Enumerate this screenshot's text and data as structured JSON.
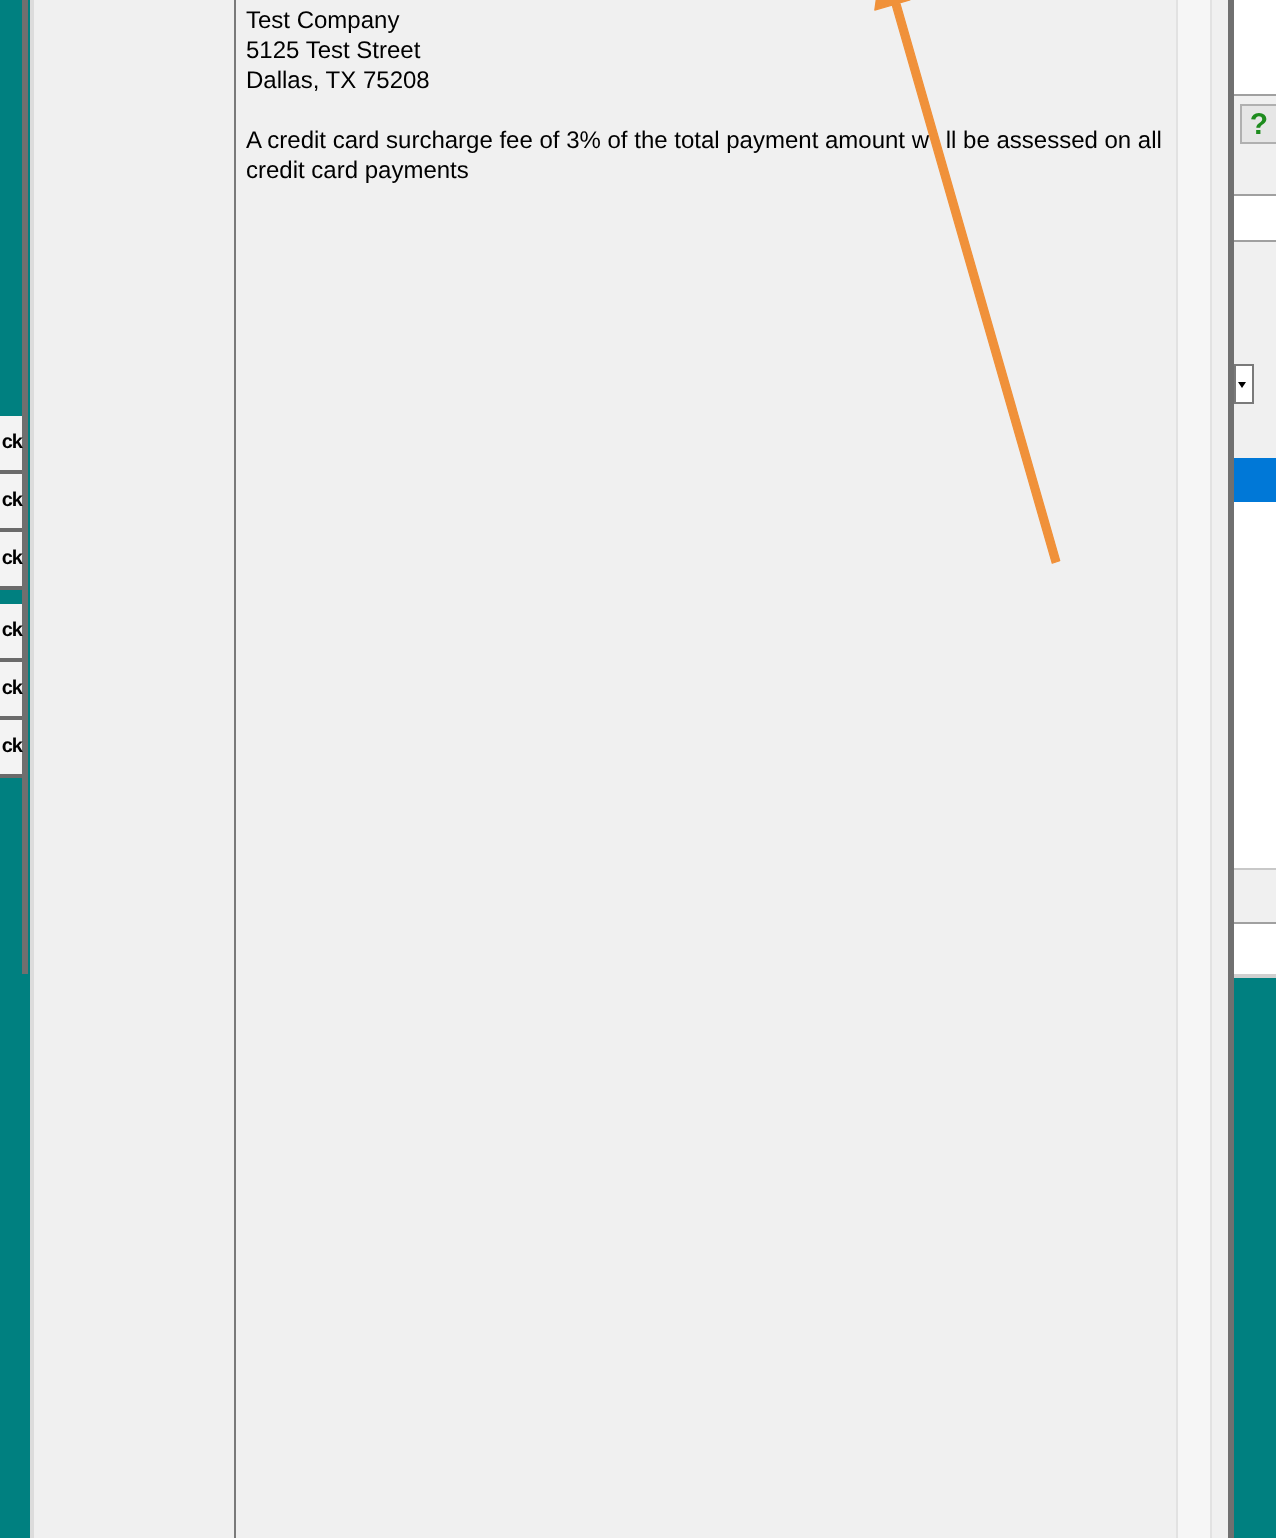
{
  "side_panel": {
    "button_groups": [
      {
        "buttons": [
          {
            "label": "ck"
          },
          {
            "label": "ck"
          },
          {
            "label": "ck"
          }
        ]
      },
      {
        "buttons": [
          {
            "label": "ck"
          },
          {
            "label": "ck"
          },
          {
            "label": "ck"
          }
        ]
      }
    ]
  },
  "dialog": {
    "address_lines": [
      "Test Company",
      "5125 Test Street",
      "Dallas, TX 75208"
    ],
    "note_parts": [
      "A credit card surcharge fee of 3% of the total payment amount w",
      "ll be assessed on all credit card payments"
    ]
  },
  "background_window": {
    "help_button": {
      "label": "?"
    },
    "list_rows": [
      {
        "selected": true
      }
    ]
  }
}
